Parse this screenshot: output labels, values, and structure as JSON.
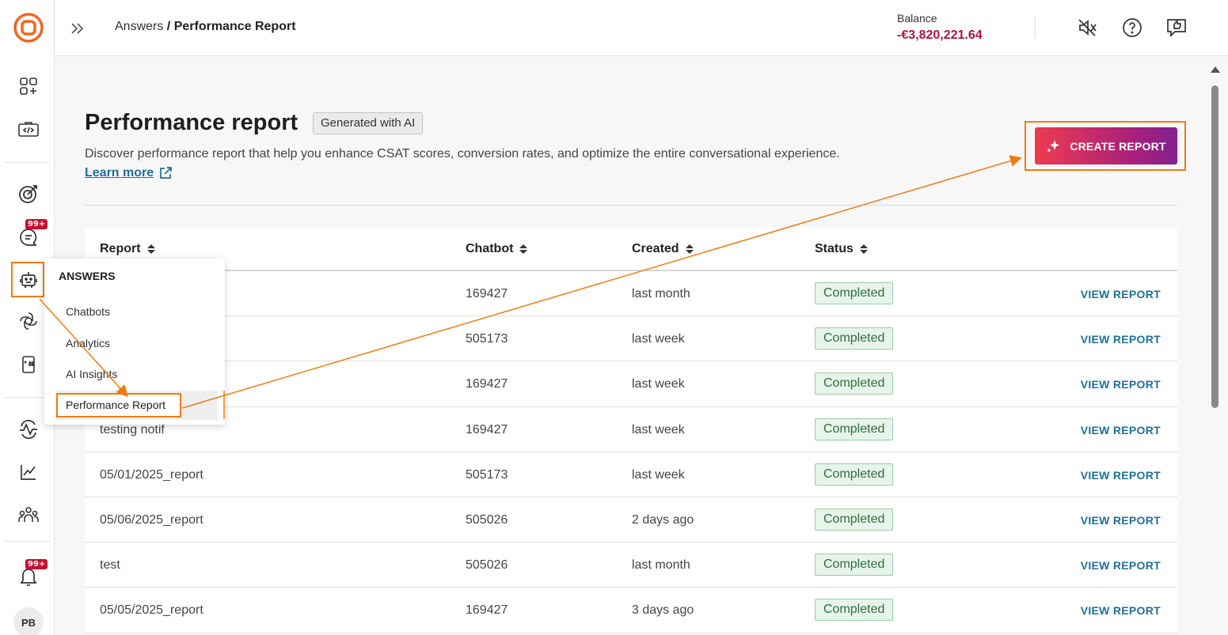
{
  "header": {
    "breadcrumb_parent": "Answers",
    "breadcrumb_sep": " / ",
    "breadcrumb_current": "Performance Report",
    "balance_label": "Balance",
    "balance_value": "-€3,820,221.64"
  },
  "sidebar": {
    "badges": [
      "99+",
      "99+"
    ],
    "avatar_initials": "PB",
    "icons": [
      "dashboard-icon",
      "code-icon",
      "target-icon",
      "chat-icon",
      "bot-icon",
      "openai-icon",
      "phone-hash-icon",
      "pulse-icon",
      "chart-icon",
      "team-icon",
      "bell-icon"
    ]
  },
  "submenu": {
    "title": "ANSWERS",
    "items": [
      "Chatbots",
      "Analytics",
      "AI Insights",
      "Performance Report"
    ]
  },
  "main": {
    "title": "Performance report",
    "ai_tag": "Generated with AI",
    "description": "Discover performance report that help you enhance CSAT scores, conversion rates, and optimize the entire conversational experience.",
    "learn_more": "Learn more",
    "create_button": "CREATE REPORT"
  },
  "table": {
    "columns": [
      "Report",
      "Chatbot",
      "Created",
      "Status"
    ],
    "rows": [
      {
        "report": "",
        "chatbot": "169427",
        "created": "last month",
        "status": "Completed",
        "action": "VIEW REPORT"
      },
      {
        "report": "",
        "chatbot": "505173",
        "created": "last week",
        "status": "Completed",
        "action": "VIEW REPORT"
      },
      {
        "report": "",
        "chatbot": "169427",
        "created": "last week",
        "status": "Completed",
        "action": "VIEW REPORT"
      },
      {
        "report": "testing notif",
        "chatbot": "169427",
        "created": "last week",
        "status": "Completed",
        "action": "VIEW REPORT"
      },
      {
        "report": "05/01/2025_report",
        "chatbot": "505173",
        "created": "last week",
        "status": "Completed",
        "action": "VIEW REPORT"
      },
      {
        "report": "05/06/2025_report",
        "chatbot": "505026",
        "created": "2 days ago",
        "status": "Completed",
        "action": "VIEW REPORT"
      },
      {
        "report": "test",
        "chatbot": "505026",
        "created": "last month",
        "status": "Completed",
        "action": "VIEW REPORT"
      },
      {
        "report": "05/05/2025_report",
        "chatbot": "169427",
        "created": "3 days ago",
        "status": "Completed",
        "action": "VIEW REPORT"
      }
    ]
  },
  "colors": {
    "accent_orange": "#f07c12",
    "brand_orange": "#f26522",
    "balance_red": "#b3123c",
    "link_blue": "#1f6f97",
    "status_green_bg": "#e7f4ea",
    "create_gradient_start": "#ee3b4f",
    "create_gradient_end": "#83208f"
  }
}
